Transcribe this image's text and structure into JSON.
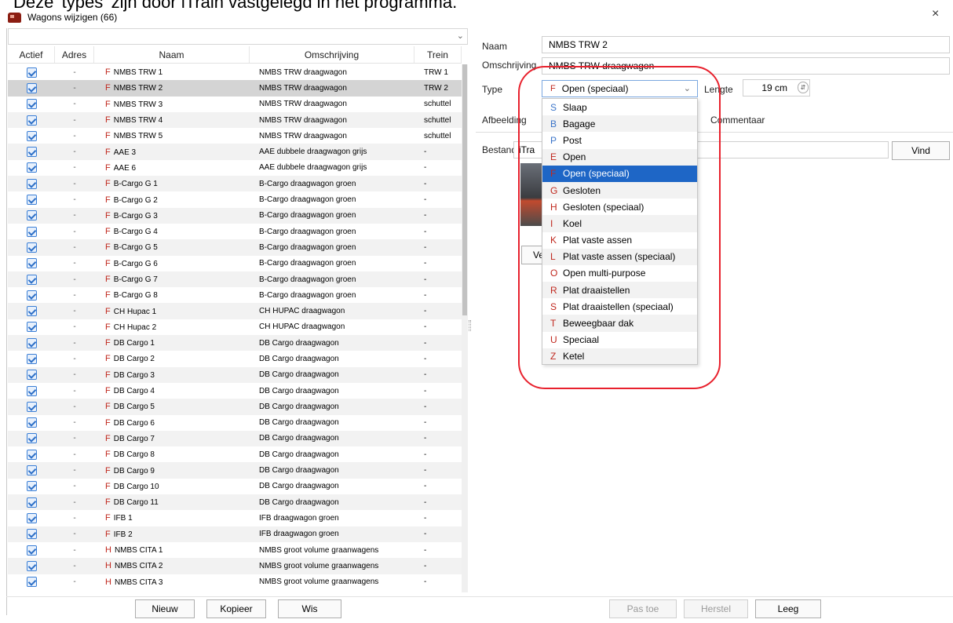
{
  "doc_caption": "Deze 'types' zijn door iTrain vastgelegd in het programma.",
  "window": {
    "title": "Wagons wijzigen (66)",
    "close_glyph": "×"
  },
  "table": {
    "columns": [
      "Actief",
      "Adres",
      "Naam",
      "Omschrijving",
      "Trein"
    ],
    "rows": [
      {
        "addr": "-",
        "code": "F",
        "name": "NMBS TRW 1",
        "desc": "NMBS TRW draagwagon",
        "train": "TRW 1"
      },
      {
        "addr": "-",
        "code": "F",
        "name": "NMBS TRW 2",
        "desc": "NMBS TRW draagwagon",
        "train": "TRW 2"
      },
      {
        "addr": "-",
        "code": "F",
        "name": "NMBS TRW 3",
        "desc": "NMBS TRW draagwagon",
        "train": "schuttel"
      },
      {
        "addr": "-",
        "code": "F",
        "name": "NMBS TRW 4",
        "desc": "NMBS TRW draagwagon",
        "train": "schuttel"
      },
      {
        "addr": "-",
        "code": "F",
        "name": "NMBS TRW 5",
        "desc": "NMBS TRW draagwagon",
        "train": "schuttel"
      },
      {
        "addr": "-",
        "code": "F",
        "name": "AAE 3",
        "desc": "AAE dubbele draagwagon grijs",
        "train": "-"
      },
      {
        "addr": "-",
        "code": "F",
        "name": "AAE 6",
        "desc": "AAE dubbele draagwagon grijs",
        "train": "-"
      },
      {
        "addr": "-",
        "code": "F",
        "name": "B-Cargo G 1",
        "desc": "B-Cargo draagwagon groen",
        "train": "-"
      },
      {
        "addr": "-",
        "code": "F",
        "name": "B-Cargo G 2",
        "desc": "B-Cargo draagwagon groen",
        "train": "-"
      },
      {
        "addr": "-",
        "code": "F",
        "name": "B-Cargo G 3",
        "desc": "B-Cargo draagwagon groen",
        "train": "-"
      },
      {
        "addr": "-",
        "code": "F",
        "name": "B-Cargo G 4",
        "desc": "B-Cargo draagwagon groen",
        "train": "-"
      },
      {
        "addr": "-",
        "code": "F",
        "name": "B-Cargo G 5",
        "desc": "B-Cargo draagwagon groen",
        "train": "-"
      },
      {
        "addr": "-",
        "code": "F",
        "name": "B-Cargo G 6",
        "desc": "B-Cargo draagwagon groen",
        "train": "-"
      },
      {
        "addr": "-",
        "code": "F",
        "name": "B-Cargo G 7",
        "desc": "B-Cargo draagwagon groen",
        "train": "-"
      },
      {
        "addr": "-",
        "code": "F",
        "name": "B-Cargo G 8",
        "desc": "B-Cargo draagwagon groen",
        "train": "-"
      },
      {
        "addr": "-",
        "code": "F",
        "name": "CH Hupac 1",
        "desc": "CH HUPAC draagwagon",
        "train": "-"
      },
      {
        "addr": "-",
        "code": "F",
        "name": "CH Hupac 2",
        "desc": "CH HUPAC draagwagon",
        "train": "-"
      },
      {
        "addr": "-",
        "code": "F",
        "name": "DB Cargo 1",
        "desc": "DB Cargo draagwagon",
        "train": "-"
      },
      {
        "addr": "-",
        "code": "F",
        "name": "DB Cargo 2",
        "desc": "DB Cargo draagwagon",
        "train": "-"
      },
      {
        "addr": "-",
        "code": "F",
        "name": "DB Cargo 3",
        "desc": "DB Cargo draagwagon",
        "train": "-"
      },
      {
        "addr": "-",
        "code": "F",
        "name": "DB Cargo 4",
        "desc": "DB Cargo draagwagon",
        "train": "-"
      },
      {
        "addr": "-",
        "code": "F",
        "name": "DB Cargo 5",
        "desc": "DB Cargo draagwagon",
        "train": "-"
      },
      {
        "addr": "-",
        "code": "F",
        "name": "DB Cargo 6",
        "desc": "DB Cargo draagwagon",
        "train": "-"
      },
      {
        "addr": "-",
        "code": "F",
        "name": "DB Cargo 7",
        "desc": "DB Cargo draagwagon",
        "train": "-"
      },
      {
        "addr": "-",
        "code": "F",
        "name": "DB Cargo 8",
        "desc": "DB Cargo draagwagon",
        "train": "-"
      },
      {
        "addr": "-",
        "code": "F",
        "name": "DB Cargo 9",
        "desc": "DB Cargo draagwagon",
        "train": "-"
      },
      {
        "addr": "-",
        "code": "F",
        "name": "DB Cargo 10",
        "desc": "DB Cargo draagwagon",
        "train": "-"
      },
      {
        "addr": "-",
        "code": "F",
        "name": "DB Cargo 11",
        "desc": "DB Cargo draagwagon",
        "train": "-"
      },
      {
        "addr": "-",
        "code": "F",
        "name": "IFB 1",
        "desc": "IFB draagwagon groen",
        "train": "-"
      },
      {
        "addr": "-",
        "code": "F",
        "name": "IFB 2",
        "desc": "IFB draagwagon groen",
        "train": "-"
      },
      {
        "addr": "-",
        "code": "H",
        "name": "NMBS CITA 1",
        "desc": "NMBS groot volume graanwagens",
        "train": "-"
      },
      {
        "addr": "-",
        "code": "H",
        "name": "NMBS CITA 2",
        "desc": "NMBS groot volume graanwagens",
        "train": "-"
      },
      {
        "addr": "-",
        "code": "H",
        "name": "NMBS CITA 3",
        "desc": "NMBS groot volume graanwagens",
        "train": "-"
      }
    ],
    "selected_index": 1
  },
  "left_buttons": {
    "new": "Nieuw",
    "copy": "Kopieer",
    "delete": "Wis"
  },
  "form": {
    "name_label": "Naam",
    "name_value": "NMBS TRW 2",
    "desc_label": "Omschrijving",
    "desc_value": "NMBS TRW draagwagon",
    "type_label": "Type",
    "type_code": "F",
    "type_value": "Open (speciaal)",
    "length_label": "Lengte",
    "length_value": "19 cm",
    "tab_image": "Afbeelding",
    "tab_comment": "Commentaar",
    "file_label": "Bestand",
    "file_value": "iTra",
    "find_button": "Vind",
    "ve_button": "Ve"
  },
  "type_options": [
    {
      "code": "S",
      "label": "Slaap",
      "color": "#3a74c9"
    },
    {
      "code": "B",
      "label": "Bagage",
      "color": "#3a74c9"
    },
    {
      "code": "P",
      "label": "Post",
      "color": "#3a74c9"
    },
    {
      "code": "E",
      "label": "Open",
      "color": "#c0281e"
    },
    {
      "code": "F",
      "label": "Open (speciaal)",
      "color": "#c0281e"
    },
    {
      "code": "G",
      "label": "Gesloten",
      "color": "#c0281e"
    },
    {
      "code": "H",
      "label": "Gesloten (speciaal)",
      "color": "#c0281e"
    },
    {
      "code": "I",
      "label": "Koel",
      "color": "#c0281e"
    },
    {
      "code": "K",
      "label": "Plat vaste assen",
      "color": "#c0281e"
    },
    {
      "code": "L",
      "label": "Plat vaste assen (speciaal)",
      "color": "#c0281e"
    },
    {
      "code": "O",
      "label": "Open multi-purpose",
      "color": "#c0281e"
    },
    {
      "code": "R",
      "label": "Plat draaistellen",
      "color": "#c0281e"
    },
    {
      "code": "S",
      "label": "Plat draaistellen (speciaal)",
      "color": "#c0281e"
    },
    {
      "code": "T",
      "label": "Beweegbaar dak",
      "color": "#c0281e"
    },
    {
      "code": "U",
      "label": "Speciaal",
      "color": "#c0281e"
    },
    {
      "code": "Z",
      "label": "Ketel",
      "color": "#c0281e"
    }
  ],
  "selected_type_index": 4,
  "bottom_buttons": {
    "apply": "Pas toe",
    "reset": "Herstel",
    "clear": "Leeg"
  },
  "colors": {
    "accent": "#1e66c6",
    "highlight": "#e8212d",
    "type_code": "#c0281e"
  }
}
